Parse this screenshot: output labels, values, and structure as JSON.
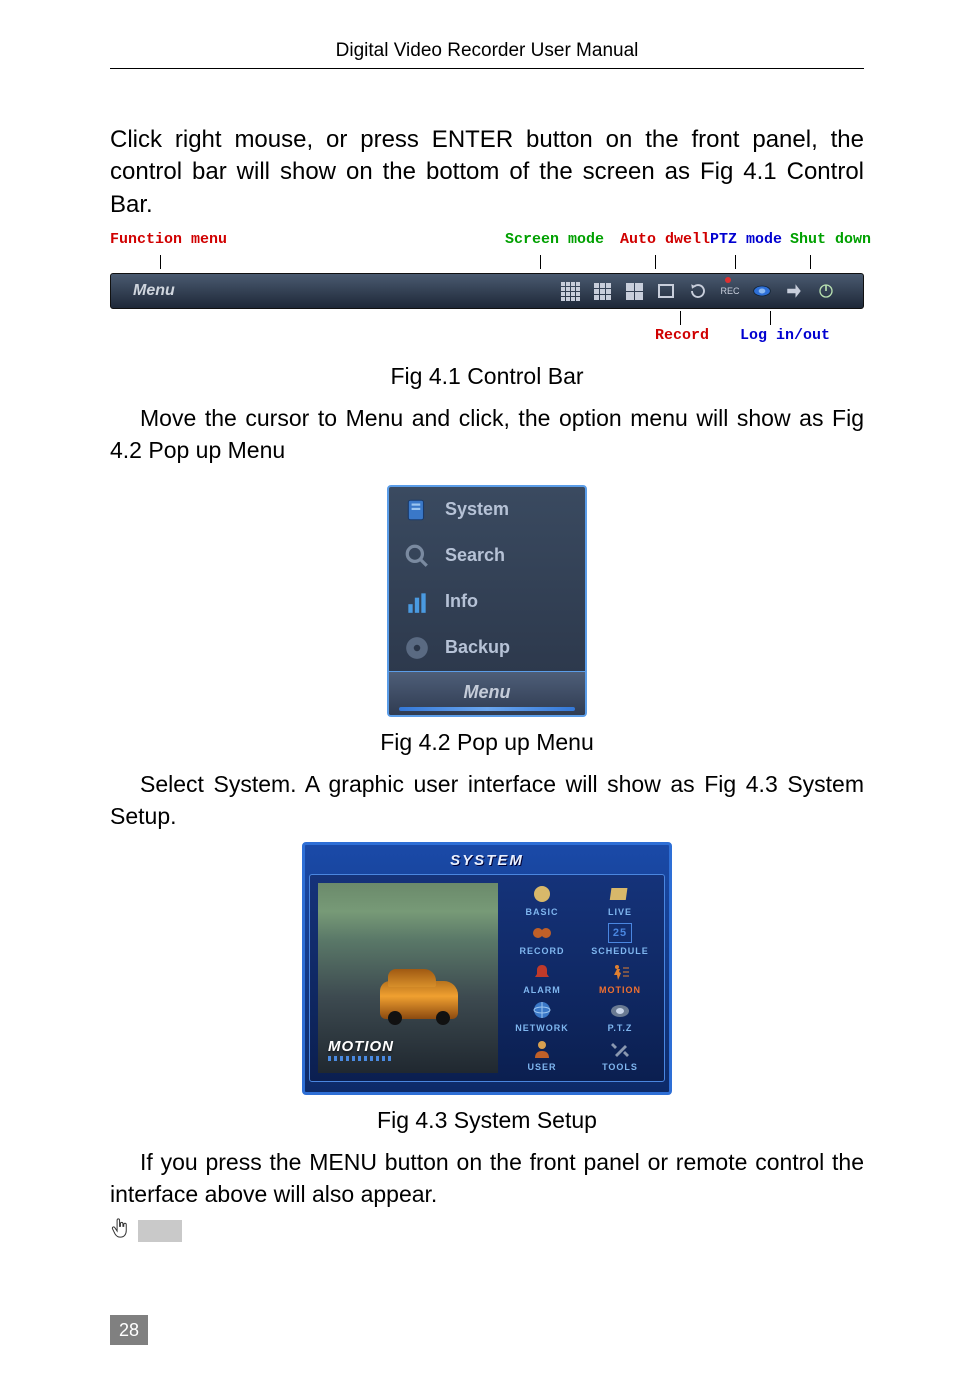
{
  "header": {
    "title": "Digital Video Recorder User Manual"
  },
  "para1": "Click right mouse, or press ENTER button on the front panel, the control bar will show on the bottom of the screen as Fig 4.1 Control Bar.",
  "ctrl_fig": {
    "labels": {
      "function_menu": "Function menu",
      "screen_mode": "Screen mode",
      "auto_dwell": "Auto dwell",
      "ptz_mode": "PTZ mode",
      "shut_down": "Shut down",
      "record": "Record",
      "log_in_out": "Log in/out"
    },
    "menu_label": "Menu",
    "rec_text": "REC"
  },
  "caption1": "Fig 4.1 Control Bar",
  "para2": "Move the cursor to Menu and click, the option menu will show as Fig 4.2 Pop up Menu",
  "popup": {
    "items": [
      "System",
      "Search",
      "Info",
      "Backup"
    ],
    "footer": "Menu"
  },
  "caption2": "Fig 4.2 Pop up Menu",
  "para3": "Select System. A graphic user interface will show as Fig 4.3 System Setup.",
  "system": {
    "title": "SYSTEM",
    "preview_label": "MOTION",
    "schedule_num": "25",
    "cells": [
      {
        "label": "BASIC"
      },
      {
        "label": "LIVE"
      },
      {
        "label": "RECORD"
      },
      {
        "label": "SCHEDULE"
      },
      {
        "label": "ALARM"
      },
      {
        "label": "MOTION"
      },
      {
        "label": "NETWORK"
      },
      {
        "label": "P.T.Z"
      },
      {
        "label": "USER"
      },
      {
        "label": "TOOLS"
      }
    ]
  },
  "caption3": "Fig 4.3 System Setup",
  "para4": "If you press the MENU button on the front panel or remote control the interface above will also appear.",
  "page_number": "28"
}
